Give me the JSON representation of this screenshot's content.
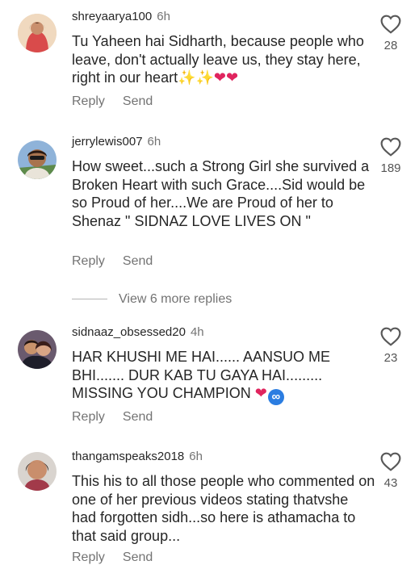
{
  "comments": [
    {
      "username": "shreyaarya100",
      "time": "6h",
      "text": "Tu Yaheen hai Sidharth, because people who leave, don't actually leave us, they stay here, right in our heart",
      "likes": "28",
      "reply_label": "Reply",
      "send_label": "Send",
      "emojis": [
        "sparkles",
        "sparkles",
        "red-heart",
        "red-heart"
      ]
    },
    {
      "username": "jerrylewis007",
      "time": "6h",
      "text": "How sweet...such a Strong Girl she survived a Broken Heart with such Grace....Sid would be so Proud of her....We are Proud of her to Shenaz \" SIDNAZ LOVE LIVES ON \"",
      "likes": "189",
      "reply_label": "Reply",
      "send_label": "Send"
    },
    {
      "username": "sidnaaz_obsessed20",
      "time": "4h",
      "text": "HAR KHUSHI ME HAI...... AANSUO ME BHI....... DUR KAB TU GAYA HAI......... MISSING YOU CHAMPION",
      "likes": "23",
      "reply_label": "Reply",
      "send_label": "Send",
      "emojis": [
        "red-heart",
        "infinity"
      ]
    },
    {
      "username": "thangamspeaks2018",
      "time": "6h",
      "text": "This his to all those people who commented on one of her previous videos stating thatvshe had forgotten sidh...so here is athamacha to that said group...",
      "likes": "43",
      "reply_label": "Reply",
      "send_label": "Send"
    }
  ],
  "view_more_replies": "View 6 more replies",
  "icons": {
    "like": "heart-outline-icon"
  },
  "colors": {
    "text": "#262626",
    "muted": "#737373",
    "heart": "#e0245e",
    "infinity_badge": "#2b7de1"
  }
}
